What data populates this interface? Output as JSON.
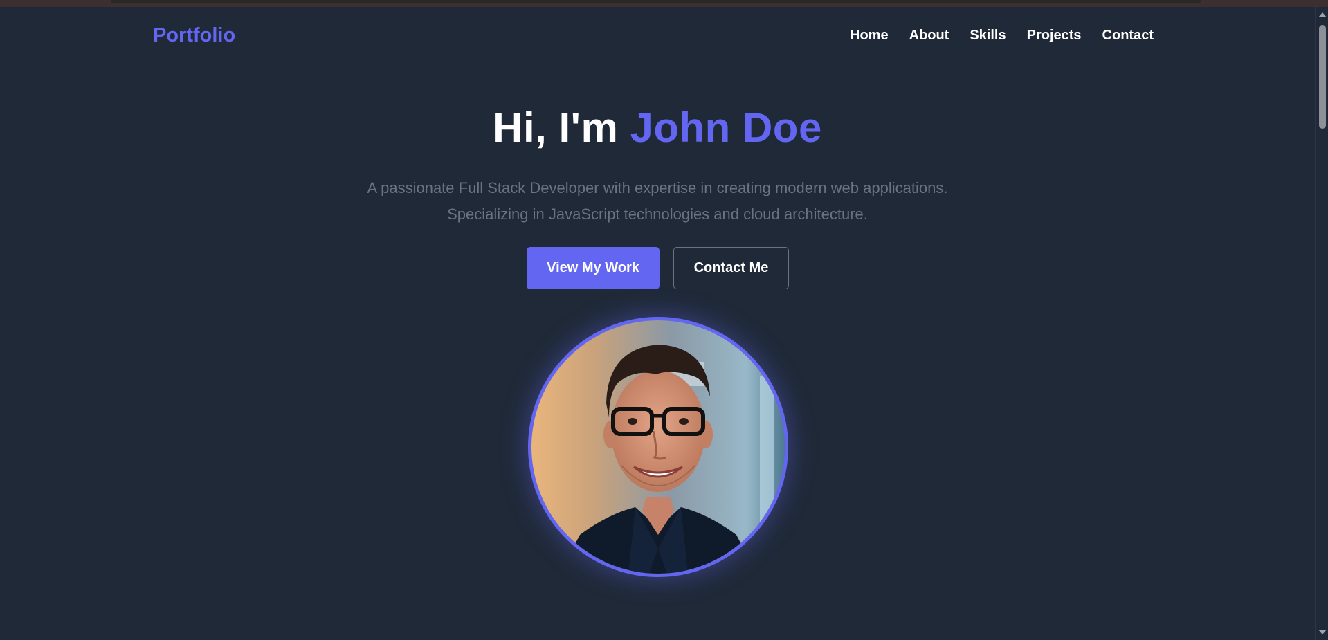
{
  "header": {
    "logo": "Portfolio",
    "nav": [
      "Home",
      "About",
      "Skills",
      "Projects",
      "Contact"
    ]
  },
  "hero": {
    "title_prefix": "Hi, I'm ",
    "title_name": "John Doe",
    "subtitle_line1": "A passionate Full Stack Developer with expertise in creating modern web applications.",
    "subtitle_line2": "Specializing in JavaScript technologies and cloud architecture.",
    "primary_button": "View My Work",
    "secondary_button": "Contact Me"
  },
  "colors": {
    "background": "#1f2937",
    "accent": "#6366f1",
    "text": "#ffffff",
    "muted": "#6b7280"
  },
  "icons": {
    "profile": "profile-photo",
    "scroll_up": "scroll-up-arrow-icon",
    "scroll_down": "scroll-down-arrow-icon"
  }
}
